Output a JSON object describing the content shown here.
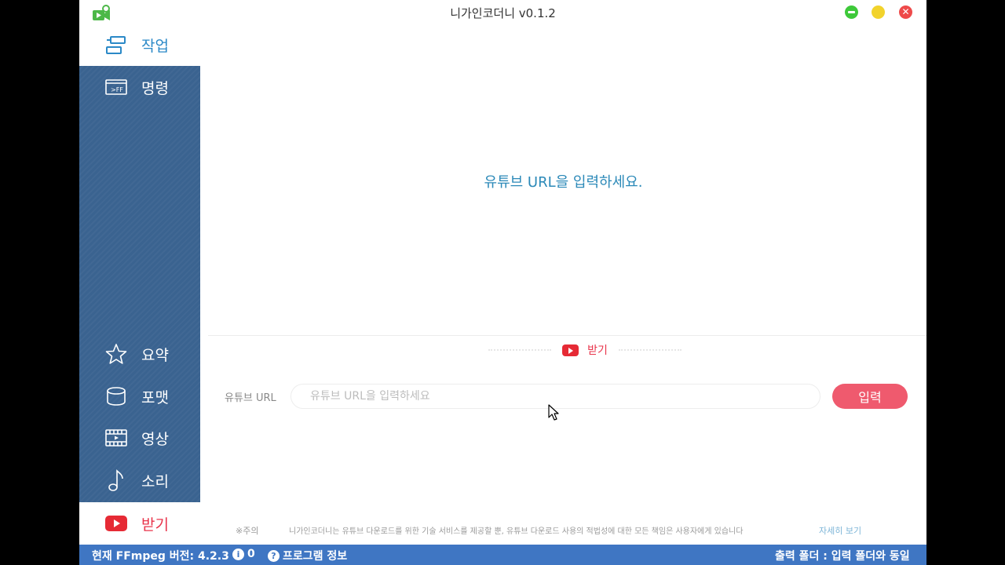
{
  "window": {
    "title": "니가인코더니 v0.1.2",
    "logo_icon": "camera-play-icon"
  },
  "window_controls": {
    "close_glyph": "✕"
  },
  "sidebar": {
    "items": [
      {
        "label": "작업",
        "icon": "tasks-icon",
        "state": "active"
      },
      {
        "label": "명령",
        "icon": "ffmpeg-command-icon"
      },
      {
        "label": "요약",
        "icon": "star-icon"
      },
      {
        "label": "포맷",
        "icon": "cylinder-icon"
      },
      {
        "label": "영상",
        "icon": "film-icon"
      },
      {
        "label": "소리",
        "icon": "music-note-icon"
      },
      {
        "label": "받기",
        "icon": "youtube-icon",
        "state": "active"
      }
    ]
  },
  "main": {
    "hint": "유튜브 URL을 입력하세요.",
    "section_title": "받기",
    "url_label": "유튜브 URL",
    "url_value": "",
    "url_placeholder": "유튜브 URL을 입력하세요",
    "enter_button": "입력",
    "notice_label": "※주의",
    "notice_text": "니가인코더니는 유튜브 다운로드를 위한 기술 서비스를 제공할 뿐, 유튜브 다운로드 사용의 적법성에 대한 모든 책임은 사용자에게 있습니다",
    "notice_link": "자세히 보기"
  },
  "statusbar": {
    "ffmpeg_version": "현재 FFmpeg 버전: 4.2.3",
    "info_count": "0",
    "info_glyph": "i",
    "program_info": "프로그램 정보",
    "program_glyph": "?",
    "output_folder": "출력 폴더 : 입력 폴더와 동일"
  },
  "colors": {
    "sidebar_bg": "#3a6390",
    "accent_blue": "#2b89c7",
    "accent_red": "#e8334a",
    "button_pink": "#ef5a6e",
    "statusbar_bg": "#3f76c3"
  }
}
